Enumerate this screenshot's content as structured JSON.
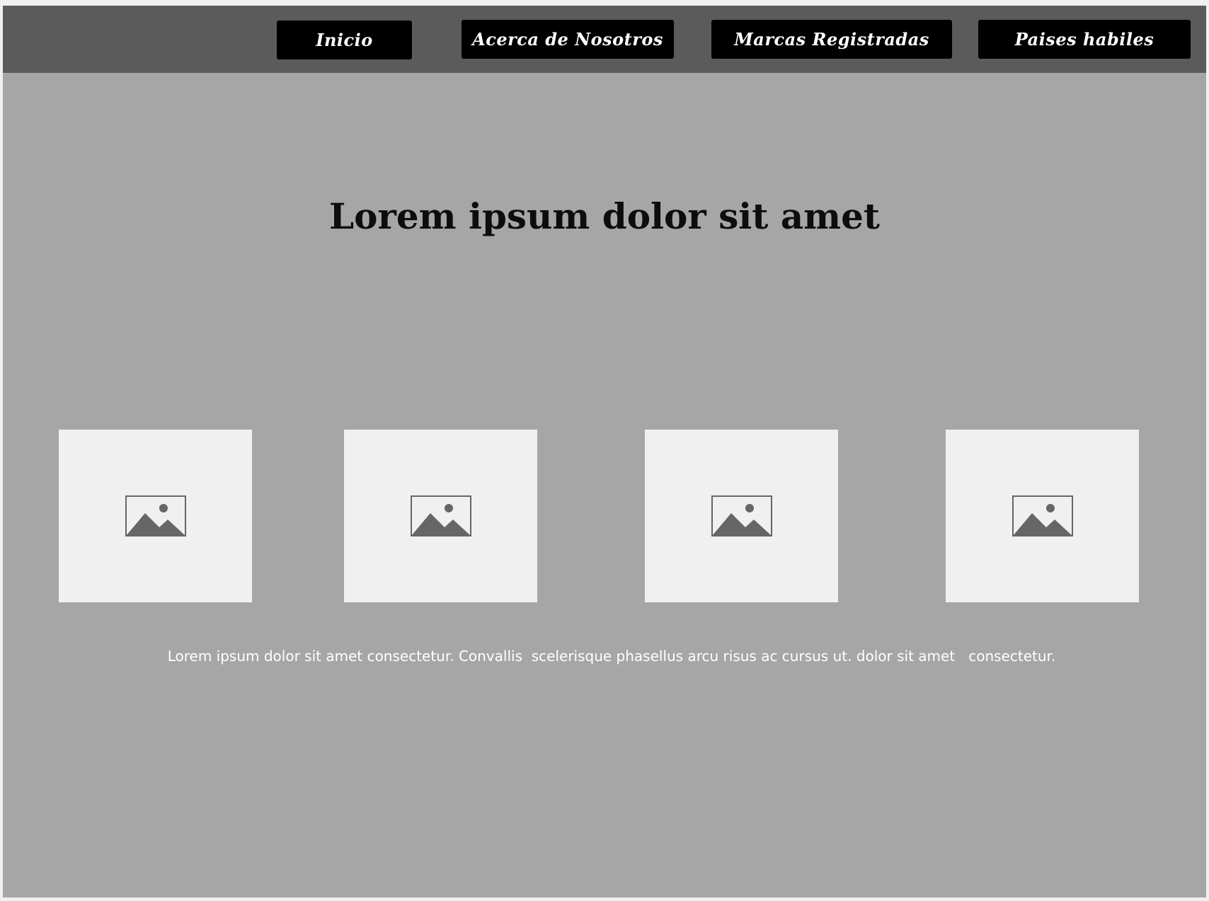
{
  "nav": {
    "items": [
      {
        "label": "Inicio"
      },
      {
        "label": "Acerca de Nosotros"
      },
      {
        "label": "Marcas Registradas"
      },
      {
        "label": "Paises habiles"
      }
    ]
  },
  "main": {
    "headline": "Lorem ipsum dolor sit amet",
    "cards": [
      {
        "icon": "image-placeholder-icon"
      },
      {
        "icon": "image-placeholder-icon"
      },
      {
        "icon": "image-placeholder-icon"
      },
      {
        "icon": "image-placeholder-icon"
      }
    ],
    "caption": "Lorem ipsum dolor sit amet consectetur. Convallis  scelerisque phasellus arcu risus ac cursus ut. dolor sit amet   consectetur."
  },
  "colors": {
    "page_background": "#a6a6a6",
    "topbar_background": "#5b5b5b",
    "nav_button_background": "#000000",
    "nav_button_text": "#ffffff",
    "card_background": "#f0f0f0",
    "icon_color": "#666666"
  }
}
